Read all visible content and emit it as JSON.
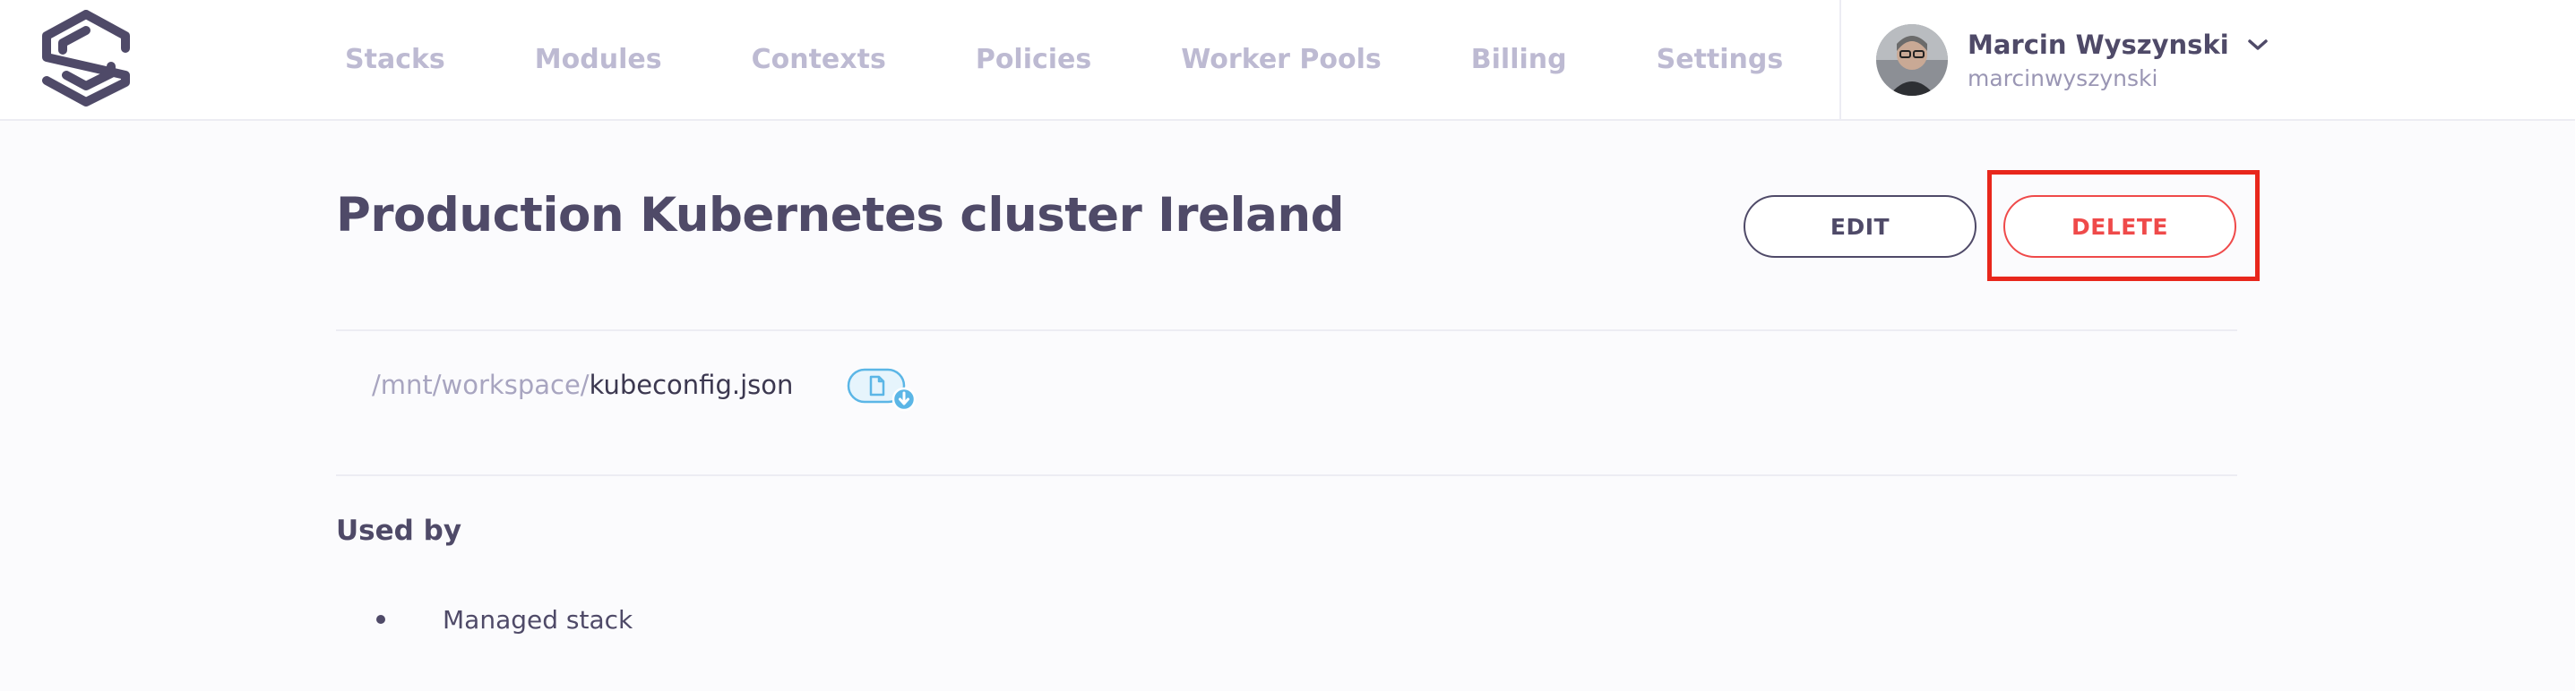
{
  "nav": {
    "items": [
      {
        "label": "Stacks"
      },
      {
        "label": "Modules"
      },
      {
        "label": "Contexts"
      },
      {
        "label": "Policies"
      },
      {
        "label": "Worker Pools"
      },
      {
        "label": "Billing"
      },
      {
        "label": "Settings"
      }
    ]
  },
  "user": {
    "name": "Marcin Wyszynski",
    "handle": "marcinwyszynski",
    "menu_icon": "chevron-down-icon"
  },
  "page": {
    "title": "Production Kubernetes cluster Ireland",
    "edit_label": "EDIT",
    "delete_label": "DELETE"
  },
  "file": {
    "directory": "/mnt/workspace/",
    "name": "kubeconfig.json",
    "download_icon": "file-download-icon"
  },
  "used_by": {
    "label": "Used by",
    "items": [
      "Managed stack"
    ]
  },
  "colors": {
    "nav_text": "#bdbad2",
    "primary_text": "#4f4a68",
    "danger": "#ef4a4a",
    "highlight": "#e8271c",
    "badge": "#5bb6e6"
  }
}
